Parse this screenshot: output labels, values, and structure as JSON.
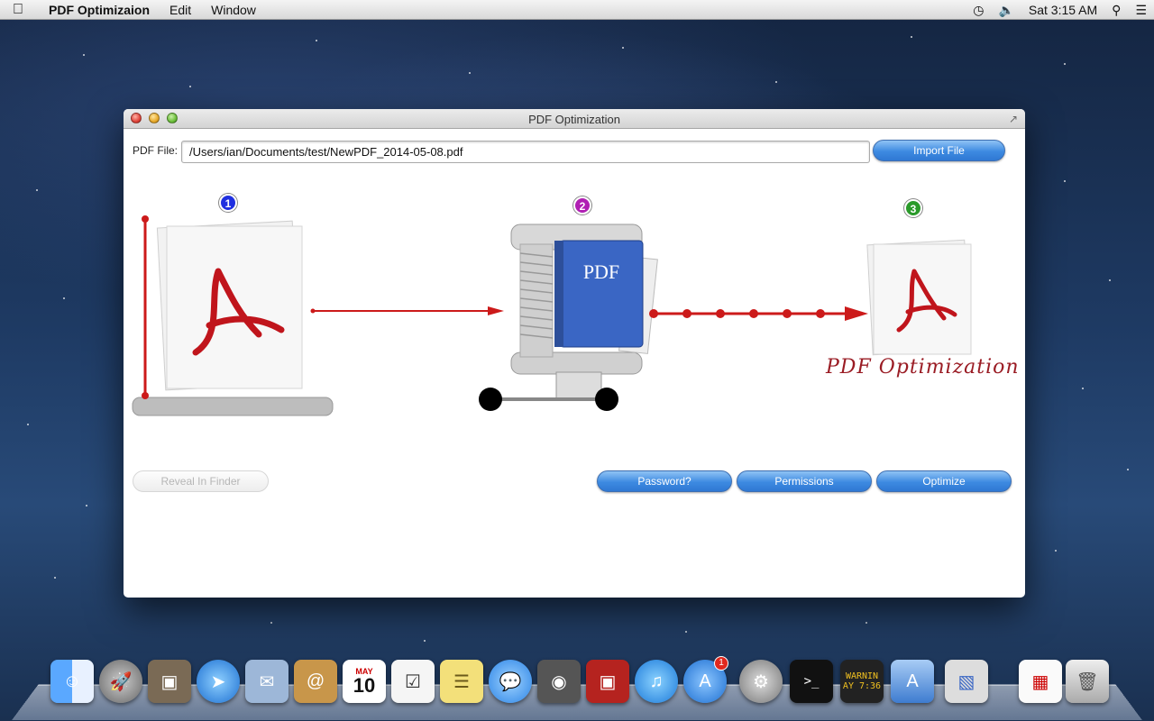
{
  "menubar": {
    "app_name": "PDF Optimizaion",
    "items": [
      "Edit",
      "Window"
    ],
    "clock": "Sat 3:15 AM"
  },
  "window": {
    "title": "PDF Optimization",
    "file_label": "PDF File:",
    "file_path": "/Users/ian/Documents/test/NewPDF_2014-05-08.pdf",
    "import_button": "Import File",
    "steps": [
      "1",
      "2",
      "3"
    ],
    "step_colors": [
      "#1f2fe0",
      "#b01fb3",
      "#2a9a2a"
    ],
    "compressor_label": "PDF",
    "result_caption": "PDF Optimization",
    "reveal_button": "Reveal In Finder",
    "password_button": "Password?",
    "permissions_button": "Permissions",
    "optimize_button": "Optimize"
  },
  "dock": {
    "items": [
      "finder-icon",
      "launchpad-icon",
      "photo-browser-icon",
      "safari-icon",
      "mail-icon",
      "contacts-icon",
      "calendar-icon",
      "reminders-icon",
      "notes-icon",
      "messages-icon",
      "facetime-icon",
      "photo-booth-icon",
      "itunes-icon",
      "app-store-icon",
      "system-preferences-icon",
      "terminal-icon",
      "console-icon",
      "xcode-icon",
      "pdf-optimization-icon",
      "document-icon",
      "trash-icon"
    ],
    "calendar_month": "MAY",
    "calendar_day": "10",
    "app_store_badge": "1",
    "console_text": "WARNIN",
    "console_text2": "AY 7:36"
  },
  "colors": {
    "accent_red": "#cc1a1a",
    "button_blue": "#3d8ae1"
  }
}
